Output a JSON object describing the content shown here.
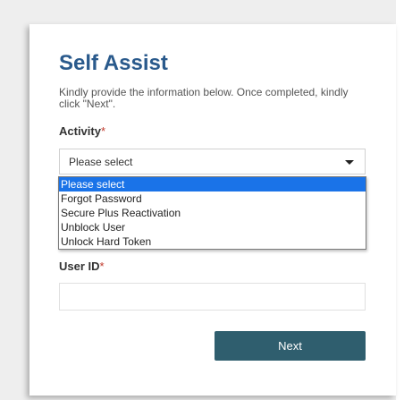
{
  "form": {
    "title": "Self Assist",
    "intro": "Kindly provide the information below. Once completed, kindly click \"Next\".",
    "activity_label": "Activity",
    "required_mark": "*",
    "activity_select": {
      "value": "Please select",
      "options": [
        "Please select",
        "Forgot Password",
        "Secure Plus Reactivation",
        "Unblock User",
        "Unlock Hard Token"
      ]
    },
    "userid_label": "User ID",
    "userid_value": "",
    "next_label": "Next"
  },
  "colors": {
    "title": "#2a5a8c",
    "required": "#c0392b",
    "selected_option": "#1a73e8",
    "button": "#2f5e6e"
  }
}
